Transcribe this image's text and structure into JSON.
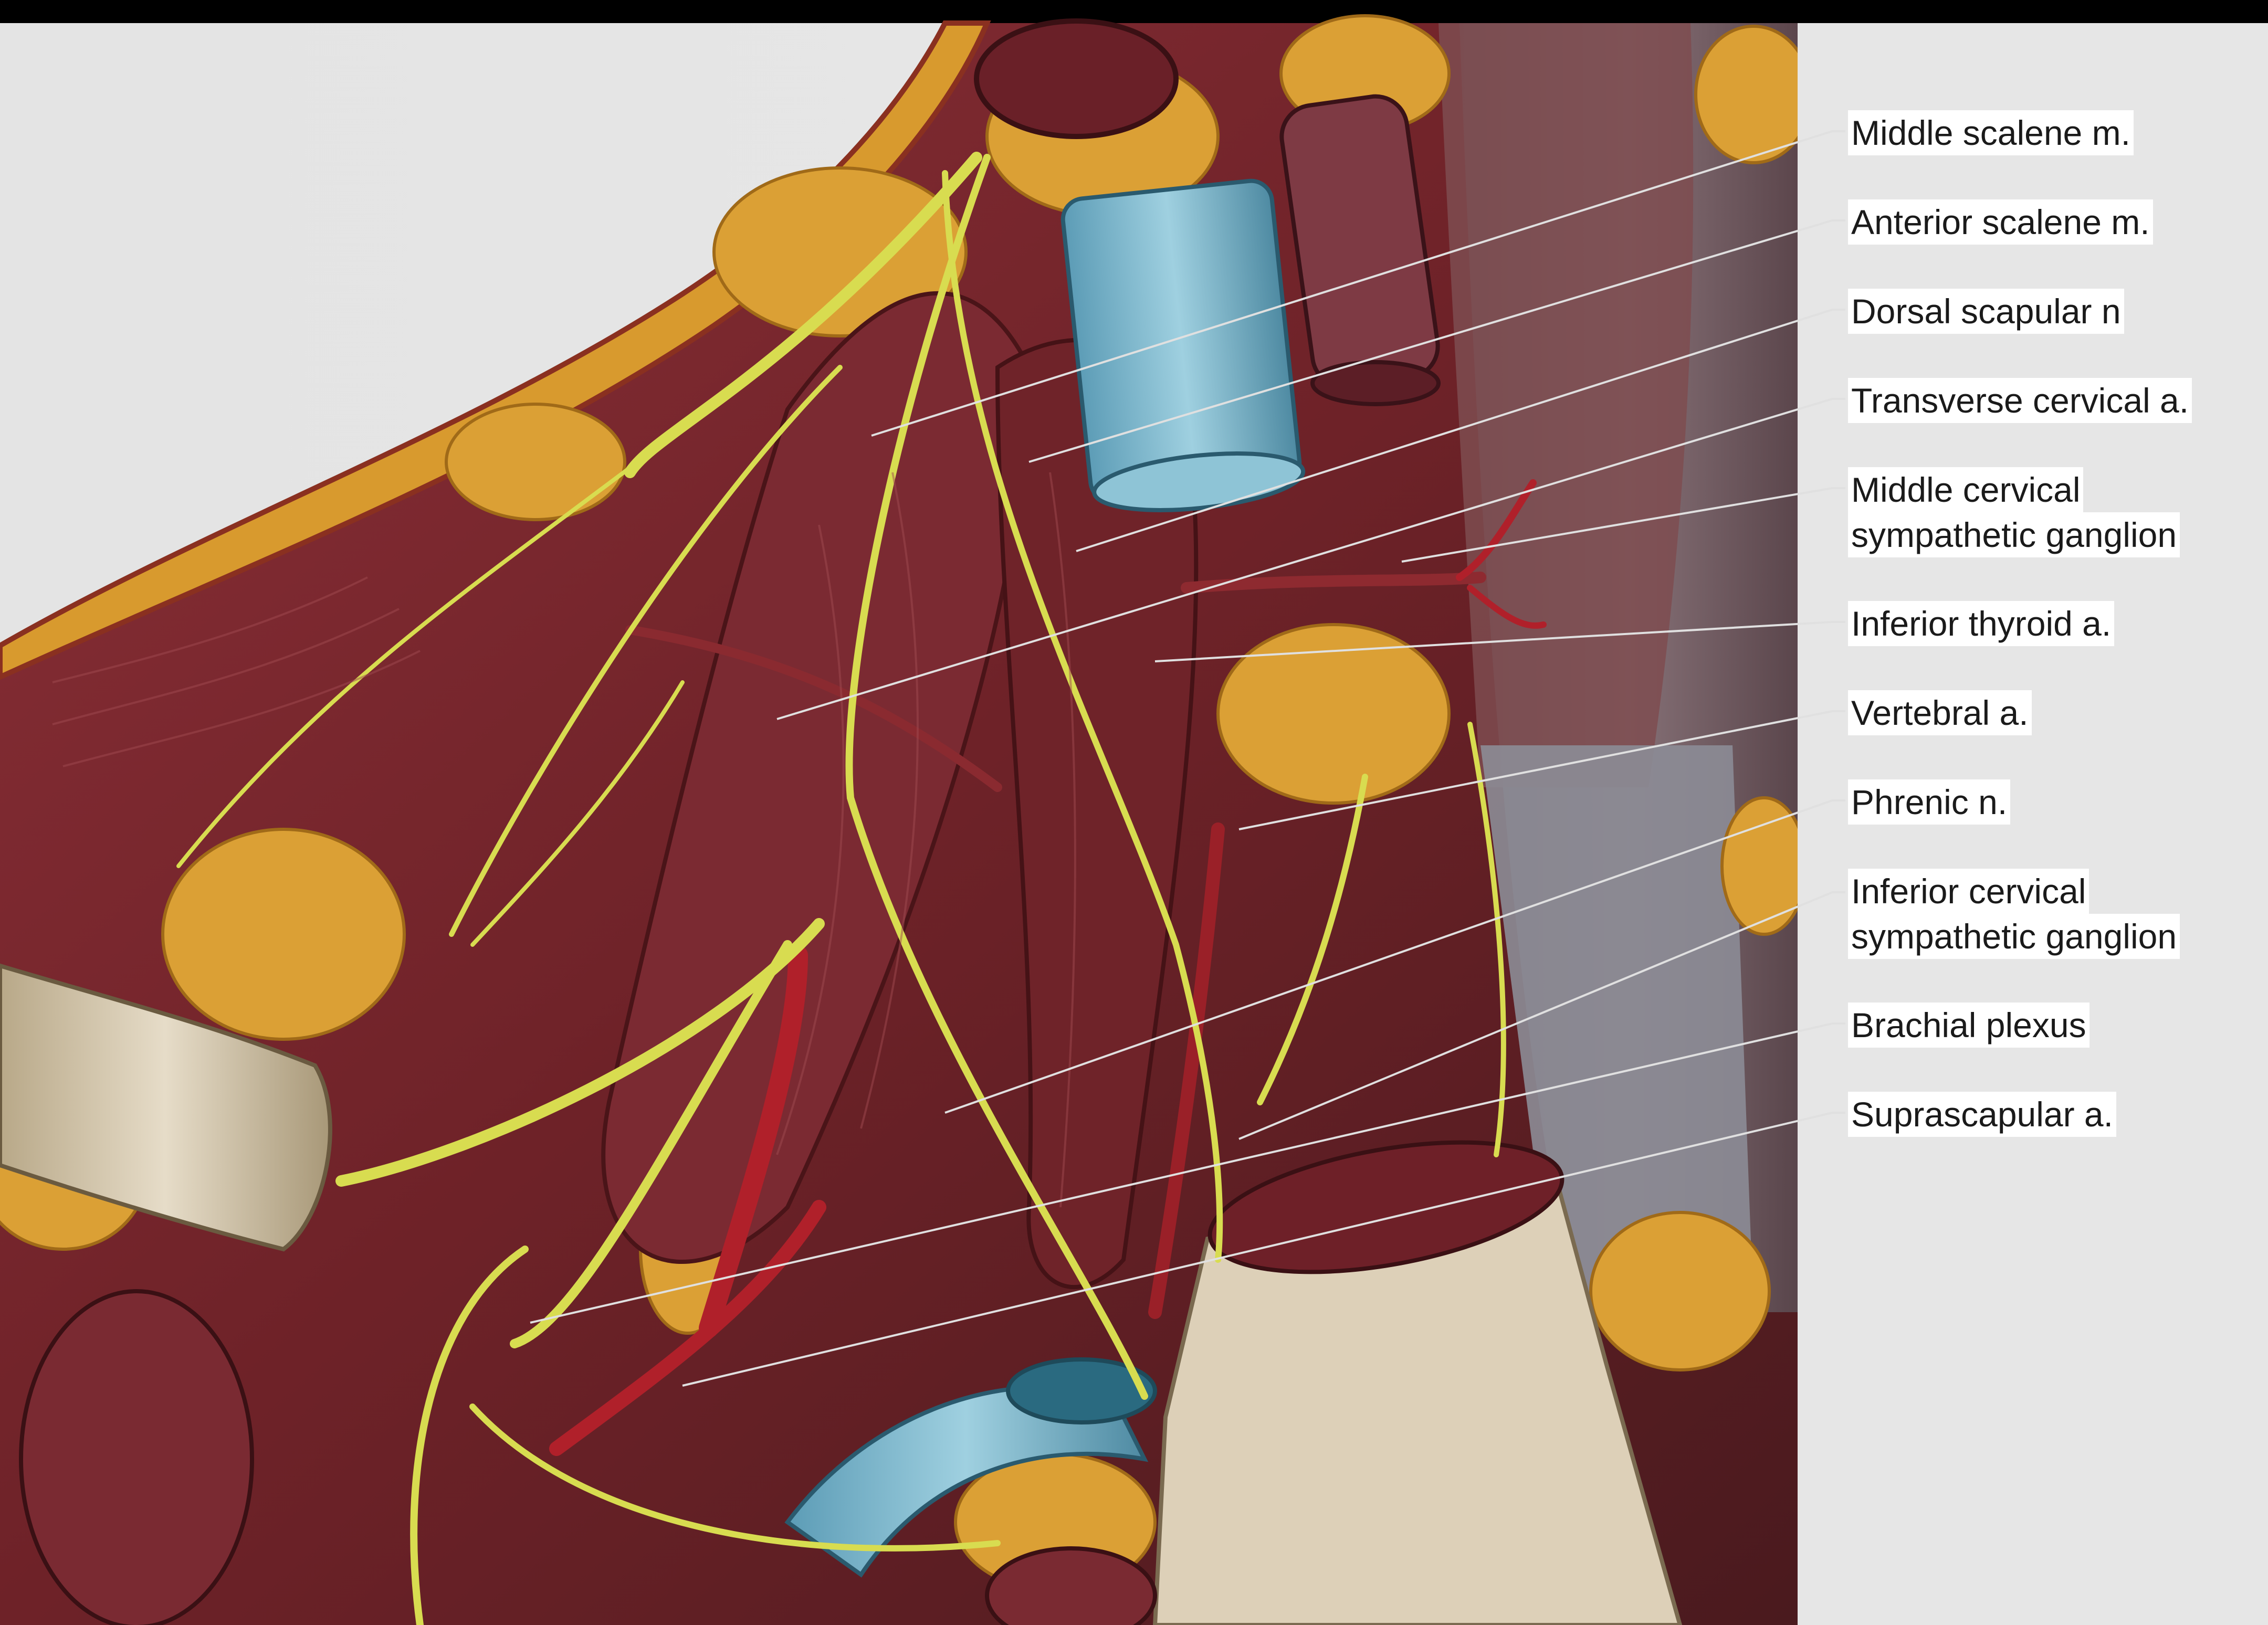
{
  "labels": [
    {
      "key": "middle_scalene",
      "lines": [
        "Middle scalene m."
      ]
    },
    {
      "key": "anterior_scalene",
      "lines": [
        "Anterior scalene m."
      ]
    },
    {
      "key": "dorsal_scapular",
      "lines": [
        "Dorsal scapular n"
      ]
    },
    {
      "key": "transverse_cervical",
      "lines": [
        "Transverse cervical a."
      ]
    },
    {
      "key": "middle_cervical_ganglion",
      "lines": [
        "Middle cervical",
        "sympathetic ganglion"
      ]
    },
    {
      "key": "inferior_thyroid",
      "lines": [
        "Inferior thyroid a."
      ]
    },
    {
      "key": "vertebral",
      "lines": [
        "Vertebral a."
      ]
    },
    {
      "key": "phrenic",
      "lines": [
        "Phrenic n."
      ]
    },
    {
      "key": "inferior_cervical_ganglion",
      "lines": [
        "Inferior cervical",
        "sympathetic ganglion"
      ]
    },
    {
      "key": "brachial_plexus",
      "lines": [
        "Brachial plexus"
      ]
    },
    {
      "key": "suprascapular",
      "lines": [
        "Suprascapular a."
      ]
    }
  ],
  "colors": {
    "background": "#e6e6e6",
    "muscle": "#7a2a30",
    "fat": "#d9a030",
    "nerve": "#d8dc50",
    "vein": "#6fb0c8",
    "artery": "#b02028",
    "leader": "#d0d0d0"
  }
}
